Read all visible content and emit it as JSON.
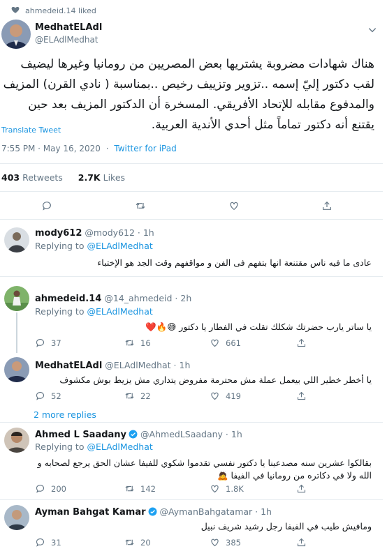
{
  "liked": {
    "text": "ahmedeid.14 liked"
  },
  "main": {
    "name": "MedhatELAdl",
    "handle": "@ELAdlMedhat",
    "text": "هناك شهادات مضروبة يشتريها بعض المصريين من رومانيا وغيرها ليضيف لقب دكتور إليّ إسمه ..تزوير وتزييف رخيص ..بمناسبة ( نادي القرن) المزيف والمدفوع مقابله للإتحاد الأفريقي. المسخرة أن الدكتور المزيف بعد حين يقتنع أنه دكتور تماماً مثل أحدي الأندية العربية.",
    "translate": "Translate Tweet",
    "time": "7:55 PM · May 16, 2020",
    "source": "Twitter for iPad",
    "retweets_count": "403",
    "retweets_label": "Retweets",
    "likes_count": "2.7K",
    "likes_label": "Likes"
  },
  "more_replies": "2 more replies",
  "replies": [
    {
      "name": "mody612",
      "handle": "@mody612 · 1h",
      "replying_prefix": "Replying to",
      "replying_to": "@ELAdlMedhat",
      "text": "عادى ما فيه ناس مقتنعة انها بتفهم فى الفن و مواقفهم وقت الجد هو الإختباء",
      "replies": "",
      "retweets": "",
      "likes": ""
    },
    {
      "name": "ahmedeid.14",
      "handle": "@14_ahmedeid · 2h",
      "replying_prefix": "Replying to",
      "replying_to": "@ELAdlMedhat",
      "text": "يا ساتر يارب حضرتك شكلك تقلت في الفطار يا دكتور 😅🔥❤️",
      "replies": "37",
      "retweets": "16",
      "likes": "661"
    },
    {
      "name": "MedhatELAdl",
      "handle": "@ELAdlMedhat · 1h",
      "text": "يا أخطر خطير اللي بيعمل عملة مش محترمة مفروض يتداري مش يزيط بوش مكشوف",
      "replies": "52",
      "retweets": "22",
      "likes": "419"
    },
    {
      "name": "Ahmed L Saadany",
      "handle": "@AhmedLSaadany · 1h",
      "replying_prefix": "Replying to",
      "replying_to": "@ELAdlMedhat",
      "text": "بقالكوا عشرين سنه مصدعينا يا دكتور نفسي تقدموا شكوي للفيفا عشان الحق يرجع لصحابه و الله ولا في دكاتره من رومانيا في الفيفا 🙇",
      "replies": "200",
      "retweets": "142",
      "likes": "1.8K"
    },
    {
      "name": "Ayman Bahgat Kamar",
      "handle": "@AymanBahgatamar · 1h",
      "text": "ومافيش طيب في الفيفا رجل رشيد شريف نبيل",
      "replies": "31",
      "retweets": "20",
      "likes": "385"
    }
  ],
  "colors": {
    "accent": "#1b95e0",
    "muted": "#657786",
    "divider": "#e6ecf0",
    "like": "#e0245e"
  },
  "icons": [
    "heart-icon",
    "chevron-down-icon",
    "reply-icon",
    "retweet-icon",
    "like-icon",
    "share-icon",
    "verified-icon"
  ]
}
